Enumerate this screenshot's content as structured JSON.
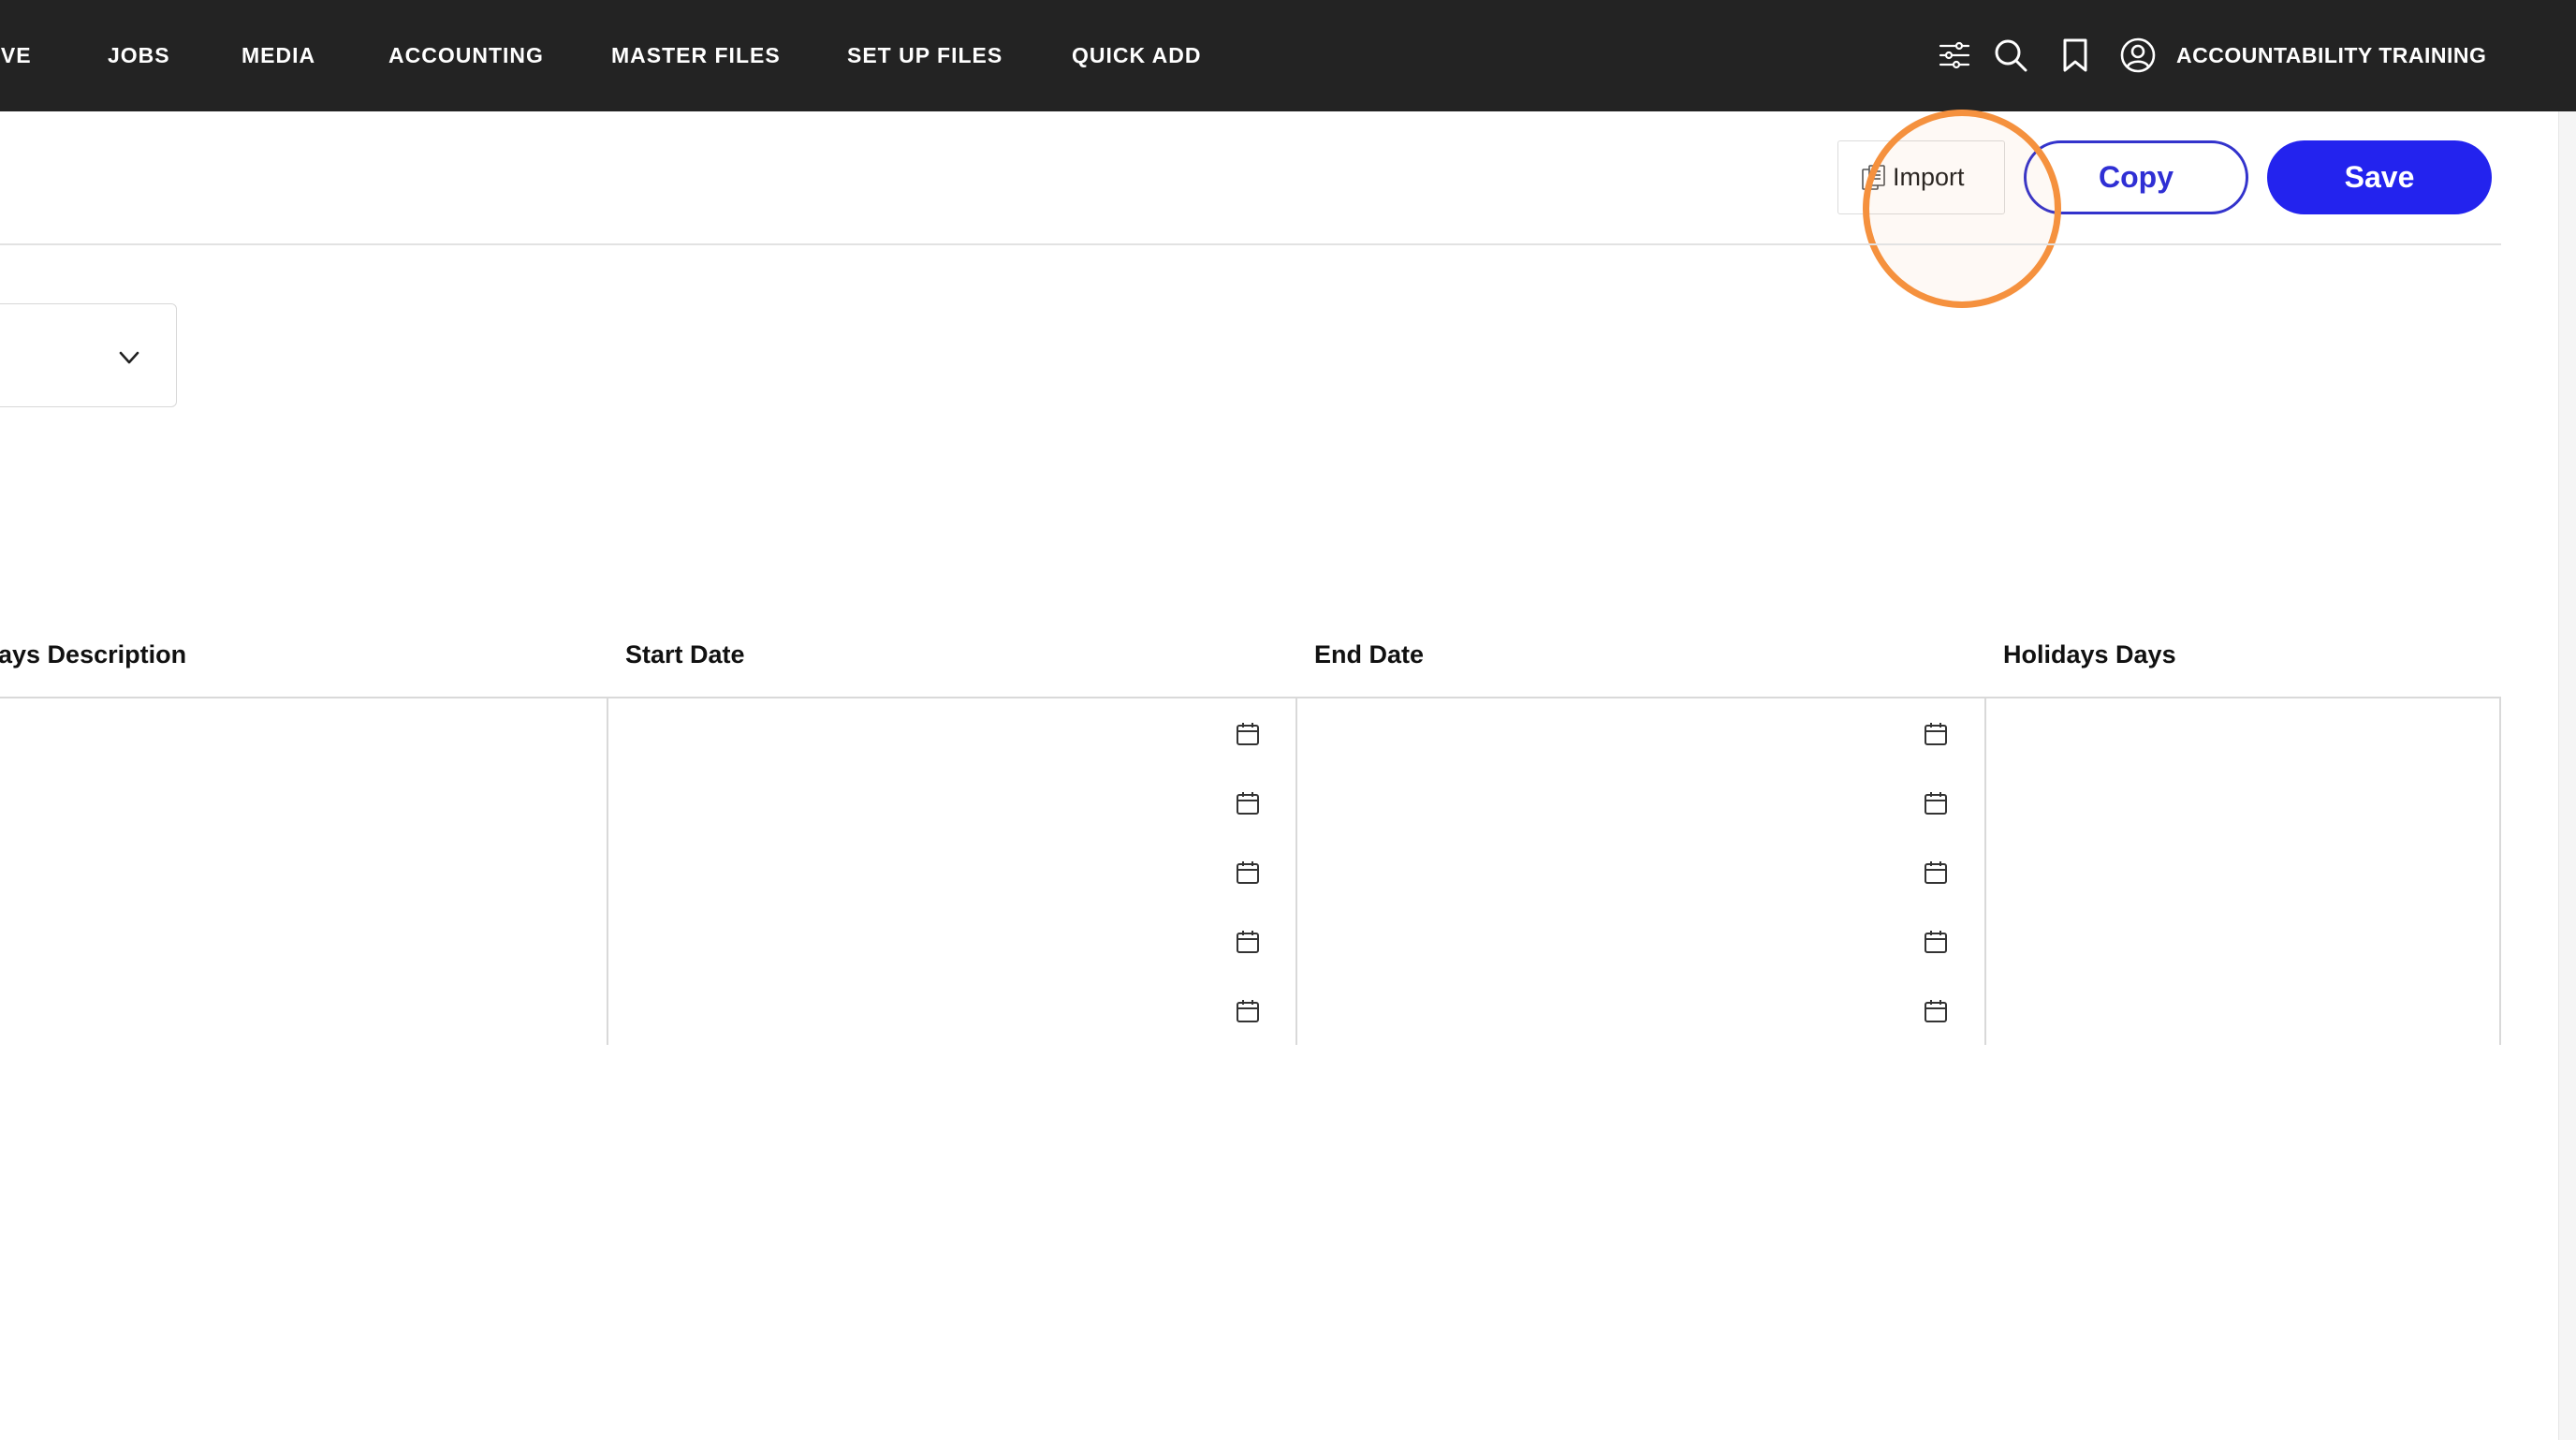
{
  "nav": {
    "items": [
      "OVE",
      "JOBS",
      "MEDIA",
      "ACCOUNTING",
      "MASTER FILES",
      "SET UP FILES",
      "QUICK ADD"
    ],
    "icons": [
      "sliders-icon",
      "search-icon",
      "bookmark-icon",
      "user-circle-icon"
    ],
    "user_name": "ACCOUNTABILITY TRAINING"
  },
  "toolbar": {
    "import_label": "Import",
    "copy_label": "Copy",
    "save_label": "Save",
    "accent_color": "#2323ee",
    "highlight_color": "#f5913e"
  },
  "dropdown": {
    "icon": "chevron-down-icon"
  },
  "table": {
    "columns": [
      "ays Description",
      "Start Date",
      "End Date",
      "Holidays Days"
    ],
    "rows": [
      {
        "description": "",
        "start_date": "",
        "end_date": "",
        "holidays_days": ""
      },
      {
        "description": "",
        "start_date": "",
        "end_date": "",
        "holidays_days": ""
      },
      {
        "description": "",
        "start_date": "",
        "end_date": "",
        "holidays_days": ""
      },
      {
        "description": "",
        "start_date": "",
        "end_date": "",
        "holidays_days": ""
      },
      {
        "description": "",
        "start_date": "",
        "end_date": "",
        "holidays_days": ""
      }
    ]
  }
}
